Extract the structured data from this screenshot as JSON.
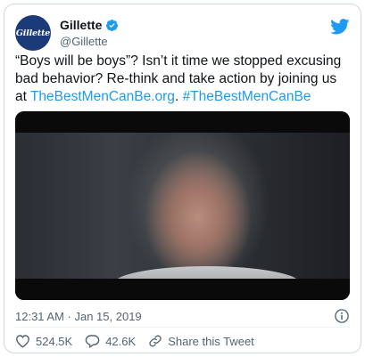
{
  "header": {
    "avatar_text": "Gillette",
    "display_name": "Gillette",
    "handle": "@Gillette"
  },
  "tweet": {
    "text": "“Boys will be boys”? Isn’t it time we stopped excusing bad behavior? Re-think and take action by joining us at ",
    "link": "TheBestMenCanBe.org",
    "separator": ". ",
    "hashtag": "#TheBestMenCanBe"
  },
  "meta": {
    "timestamp": "12:31 AM · Jan 15, 2019"
  },
  "actions": {
    "likes": "524.5K",
    "replies": "42.6K",
    "share": "Share this Tweet"
  },
  "colors": {
    "accent": "#1d9bf0",
    "like": "#f91880",
    "muted": "#536471"
  }
}
